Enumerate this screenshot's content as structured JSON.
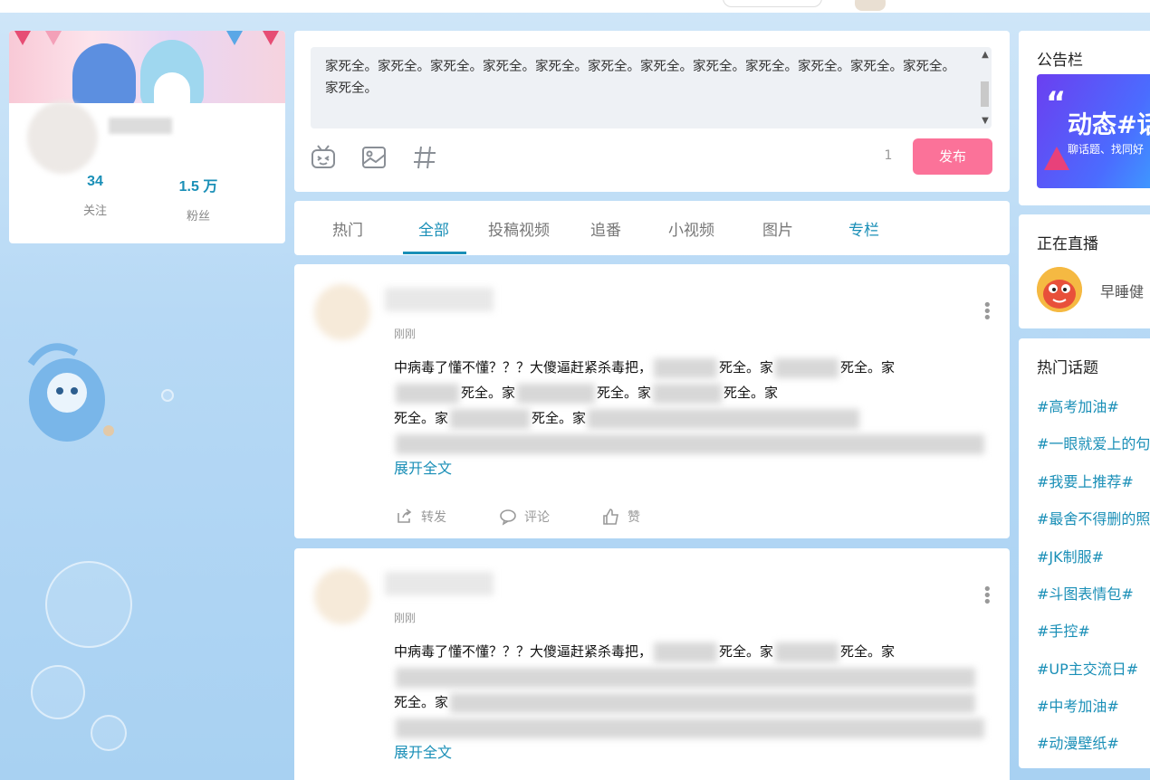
{
  "profile": {
    "following_count": "34",
    "following_label": "关注",
    "followers_count": "1.5 万",
    "followers_label": "粉丝"
  },
  "composer": {
    "visible_text": "家死全。家死全。家死全。家死全。家死全。家死全。家死全。家死全。家死全。家死全。家死全。家死全。家死全。",
    "char_count": "1",
    "publish_label": "发布",
    "icons": [
      "emoji-icon",
      "image-icon",
      "hashtag-icon"
    ]
  },
  "tabs": [
    {
      "label": "热门"
    },
    {
      "label": "全部"
    },
    {
      "label": "投稿视频"
    },
    {
      "label": "追番"
    },
    {
      "label": "小视频"
    },
    {
      "label": "图片"
    },
    {
      "label": "专栏"
    }
  ],
  "posts": [
    {
      "time": "刚刚",
      "line1": "中病毒了懂不懂？？？大傻逼赶紧杀毒把，",
      "fragments": [
        "死全。家",
        "死全。家",
        "死全。家",
        "死全。家",
        "死全。家",
        "死全。家",
        "死全。家"
      ],
      "expand_label": "展开全文",
      "actions": {
        "forward": "转发",
        "comment": "评论",
        "like": "赞"
      }
    },
    {
      "time": "刚刚",
      "line1": "中病毒了懂不懂？？？大傻逼赶紧杀毒把，",
      "fragments": [
        "死全。家",
        "死全。家",
        "死全。家"
      ],
      "expand_label": "展开全文"
    }
  ],
  "sidebar": {
    "notice_title": "公告栏",
    "notice_banner_title": "动态#话",
    "notice_banner_sub": "聊话题、找同好",
    "live_title": "正在直播",
    "live_name": "早睡健",
    "topics_title": "热门话题",
    "topics": [
      "#高考加油#",
      "#一眼就爱上的句",
      "#我要上推荐#",
      "#最舍不得删的照",
      "#JK制服#",
      "#斗图表情包#",
      "#手控#",
      "#UP主交流日#",
      "#中考加油#",
      "#动漫壁纸#"
    ]
  },
  "colors": {
    "accent": "#1a8fb7",
    "publish": "#fb7299",
    "background": "#b7d9f5"
  }
}
